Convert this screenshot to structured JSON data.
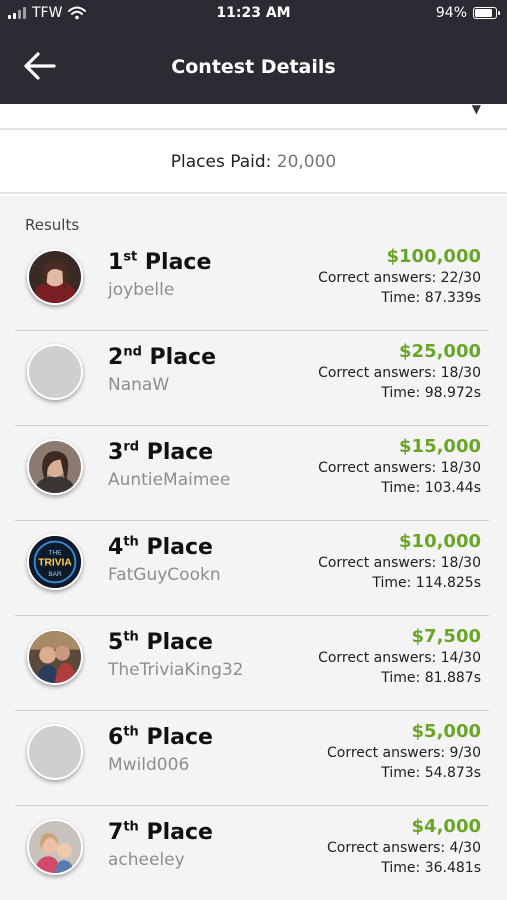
{
  "status_bar": {
    "carrier": "TFW",
    "time": "11:23 AM",
    "battery": "94%",
    "battery_level": 0.94
  },
  "nav": {
    "title": "Contest Details"
  },
  "places_paid": {
    "label": "Places Paid:",
    "value": "20,000"
  },
  "results": {
    "header": "Results",
    "rows": [
      {
        "num": "1",
        "suffix": "st",
        "place_word": "Place",
        "username": "joybelle",
        "prize": "$100,000",
        "correct": "Correct answers: 22/30",
        "time": "Time: 87.339s",
        "avatar": "photo"
      },
      {
        "num": "2",
        "suffix": "nd",
        "place_word": "Place",
        "username": "NanaW",
        "prize": "$25,000",
        "correct": "Correct answers: 18/30",
        "time": "Time: 98.972s",
        "avatar": "placeholder"
      },
      {
        "num": "3",
        "suffix": "rd",
        "place_word": "Place",
        "username": "AuntieMaimee",
        "prize": "$15,000",
        "correct": "Correct answers: 18/30",
        "time": "Time: 103.44s",
        "avatar": "photo"
      },
      {
        "num": "4",
        "suffix": "th",
        "place_word": "Place",
        "username": "FatGuyCookn",
        "prize": "$10,000",
        "correct": "Correct answers: 18/30",
        "time": "Time: 114.825s",
        "avatar": "logo",
        "logo_text": [
          "THE",
          "TRIVIA",
          "BAR"
        ]
      },
      {
        "num": "5",
        "suffix": "th",
        "place_word": "Place",
        "username": "TheTriviaKing32",
        "prize": "$7,500",
        "correct": "Correct answers: 14/30",
        "time": "Time: 81.887s",
        "avatar": "photo"
      },
      {
        "num": "6",
        "suffix": "th",
        "place_word": "Place",
        "username": "Mwild006",
        "prize": "$5,000",
        "correct": "Correct answers: 9/30",
        "time": "Time: 54.873s",
        "avatar": "placeholder"
      },
      {
        "num": "7",
        "suffix": "th",
        "place_word": "Place",
        "username": "acheeley",
        "prize": "$4,000",
        "correct": "Correct answers: 4/30",
        "time": "Time: 36.481s",
        "avatar": "photo"
      }
    ]
  },
  "colors": {
    "header_bg": "#2b2c33",
    "prize_green": "#6aa528",
    "username_gray": "#8e8e8e"
  }
}
